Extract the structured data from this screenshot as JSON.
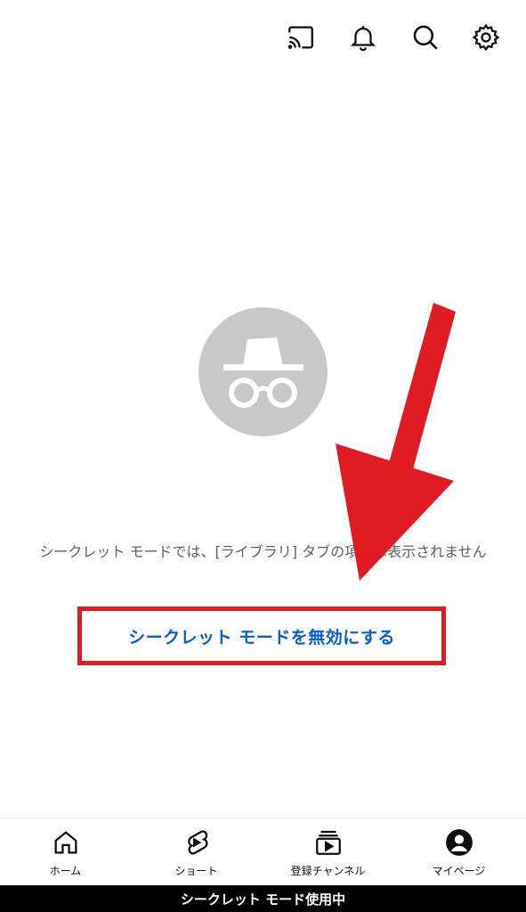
{
  "top_bar": {
    "icons": [
      "cast-icon",
      "notifications-bell-icon",
      "search-icon",
      "settings-gear-icon"
    ]
  },
  "main": {
    "incognito_icon": "incognito-hat-glasses-icon",
    "message": "シークレット モードでは、[ライブラリ] タブの項目は表示されません",
    "disable_button_label": "シークレット モードを無効にする",
    "highlight_color": "#e01b24",
    "button_text_color": "#065fd4"
  },
  "bottom_nav": {
    "items": [
      {
        "label": "ホーム",
        "icon": "home-icon"
      },
      {
        "label": "ショート",
        "icon": "shorts-icon"
      },
      {
        "label": "登録チャンネル",
        "icon": "subscriptions-icon"
      },
      {
        "label": "マイページ",
        "icon": "account-icon"
      }
    ]
  },
  "status_bar": {
    "text": "シークレット モード使用中"
  }
}
